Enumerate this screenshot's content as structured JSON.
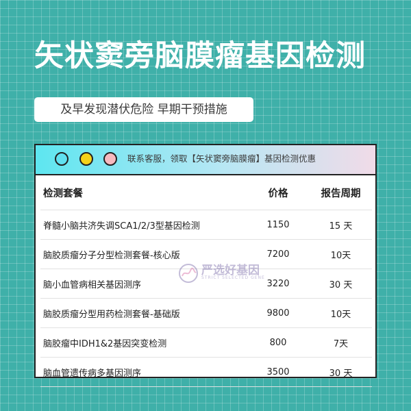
{
  "title": "矢状窦旁脑膜瘤基因检测",
  "subtitle": "及早发现潜伏危险 早期干预措施",
  "card": {
    "notice": "联系客服，领取【矢状窦旁脑膜瘤】基因检测优惠",
    "headers": [
      "检测套餐",
      "价格",
      "报告周期"
    ],
    "rows": [
      {
        "name": "脊髓小脑共济失调SCA1/2/3型基因检测",
        "price": "1150",
        "period": "15 天"
      },
      {
        "name": "脑胶质瘤分子分型检测套餐-核心版",
        "price": "7200",
        "period": "10天"
      },
      {
        "name": "脑小血管病相关基因测序",
        "price": "3220",
        "period": "30 天"
      },
      {
        "name": "脑胶质瘤分型用药检测套餐-基础版",
        "price": "9800",
        "period": "10天"
      },
      {
        "name": "脑胶瘤中IDH1&2基因突变检测",
        "price": "800",
        "period": "7天"
      },
      {
        "name": "脑血管遗传病多基因测序",
        "price": "3500",
        "period": "30 天"
      }
    ]
  },
  "watermark": {
    "text": "严选好基因",
    "sub": "STRICT SELECTED GENE"
  },
  "colors": {
    "background": "#3fb0a9",
    "dot1": "#60e1f0",
    "dot2": "#f5d21b",
    "dot3": "#f7b9bf"
  }
}
